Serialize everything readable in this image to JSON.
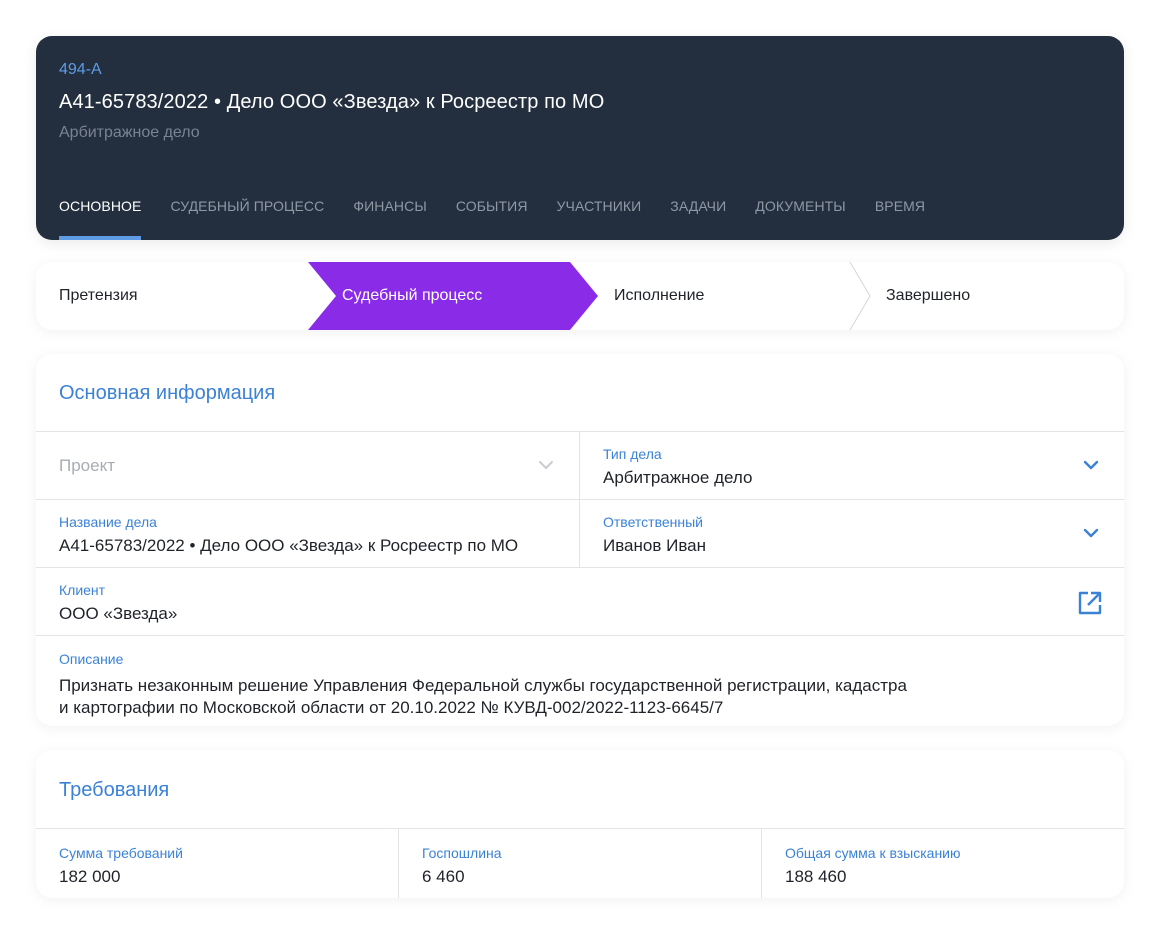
{
  "header": {
    "code": "494-A",
    "title": "А41-65783/2022 • Дело ООО «Звезда» к Росреестр по МО",
    "type": "Арбитражное дело",
    "tabs": [
      {
        "label": "Основное",
        "active": true
      },
      {
        "label": "Судебный процесс"
      },
      {
        "label": "Финансы"
      },
      {
        "label": "События"
      },
      {
        "label": "Участники"
      },
      {
        "label": "Задачи"
      },
      {
        "label": "Документы"
      },
      {
        "label": "Время"
      }
    ]
  },
  "stages": [
    {
      "label": "Претензия"
    },
    {
      "label": "Судебный процесс",
      "active": true
    },
    {
      "label": "Исполнение"
    },
    {
      "label": "Завершено"
    }
  ],
  "main_info": {
    "title": "Основная информация",
    "project": {
      "placeholder": "Проект"
    },
    "case_type": {
      "label": "Тип дела",
      "value": "Арбитражное дело"
    },
    "case_name": {
      "label": "Название дела",
      "value": "А41-65783/2022 • Дело ООО «Звезда» к Росреестр по МО"
    },
    "responsible": {
      "label": "Ответственный",
      "value": "Иванов Иван"
    },
    "client": {
      "label": "Клиент",
      "value": "ООО «Звезда»"
    },
    "description": {
      "label": "Описание",
      "line1": "Признать незаконным решение Управления Федеральной службы государственной регистрации, кадастра",
      "line2": "и картографии по Московской области от 20.10.2022 № КУВД-002/2022-1123-6645/7"
    }
  },
  "requirements": {
    "title": "Требования",
    "claim_amount": {
      "label": "Сумма требований",
      "value": "182 000"
    },
    "state_fee": {
      "label": "Госпошлина",
      "value": "6 460"
    },
    "total": {
      "label": "Общая сумма к взысканию",
      "value": "188 460"
    }
  },
  "colors": {
    "header_bg": "#232f3e",
    "accent_blue": "#3b82d6",
    "active_stage": "#8a2be8"
  }
}
